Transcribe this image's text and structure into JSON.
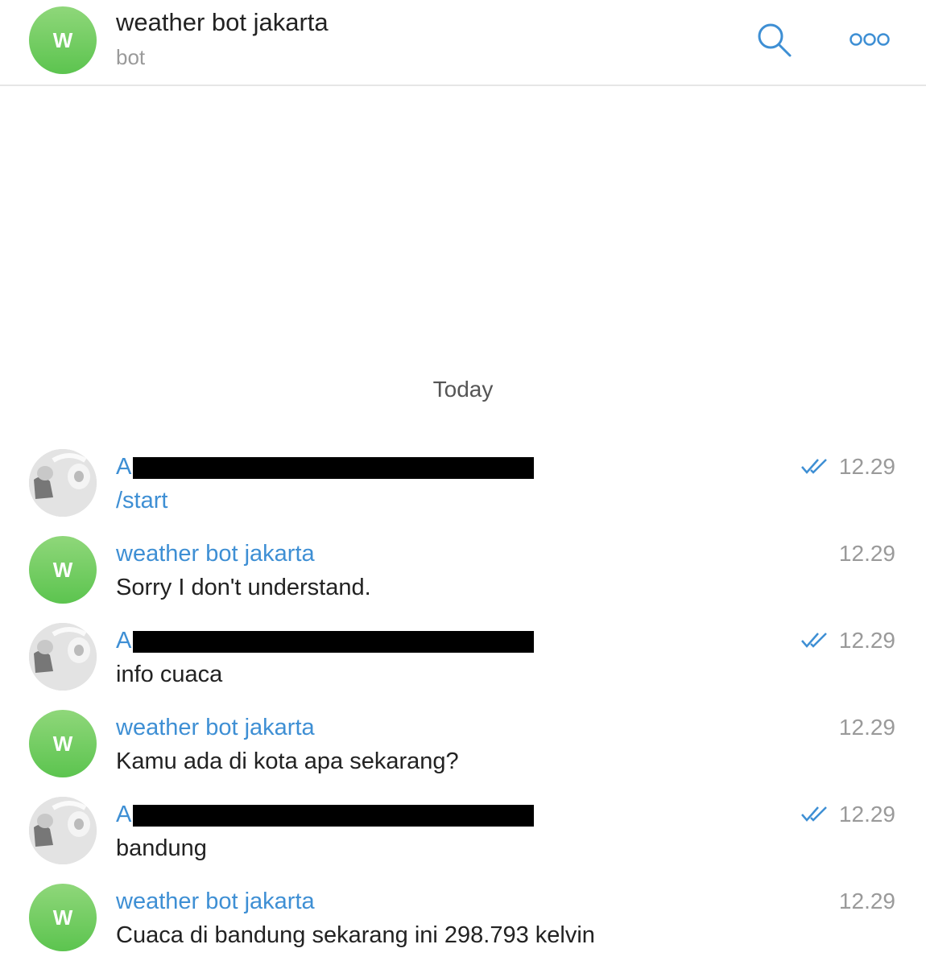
{
  "header": {
    "avatar_letter": "W",
    "title": "weather bot jakarta",
    "subtitle": "bot",
    "icons": [
      "search-icon",
      "more-icon"
    ],
    "accent_color": "#3e8fd4"
  },
  "date_separator": "Today",
  "messages": [
    {
      "sender": "A",
      "sender_redacted": true,
      "text": "/start",
      "time": "12.29",
      "read": true
    },
    {
      "sender": "weather bot jakarta",
      "avatar_letter": "W",
      "text": "Sorry I don't understand.",
      "time": "12.29",
      "read": false
    },
    {
      "sender": "A",
      "sender_redacted": true,
      "text": "info cuaca",
      "time": "12.29",
      "read": true
    },
    {
      "sender": "weather bot jakarta",
      "avatar_letter": "W",
      "text": "Kamu ada di kota apa sekarang?",
      "time": "12.29",
      "read": false
    },
    {
      "sender": "A",
      "sender_redacted": true,
      "text": "bandung",
      "time": "12.29",
      "read": true
    },
    {
      "sender": "weather bot jakarta",
      "avatar_letter": "W",
      "text": "Cuaca di bandung sekarang ini 298.793 kelvin",
      "time": "12.29",
      "read": false
    }
  ]
}
